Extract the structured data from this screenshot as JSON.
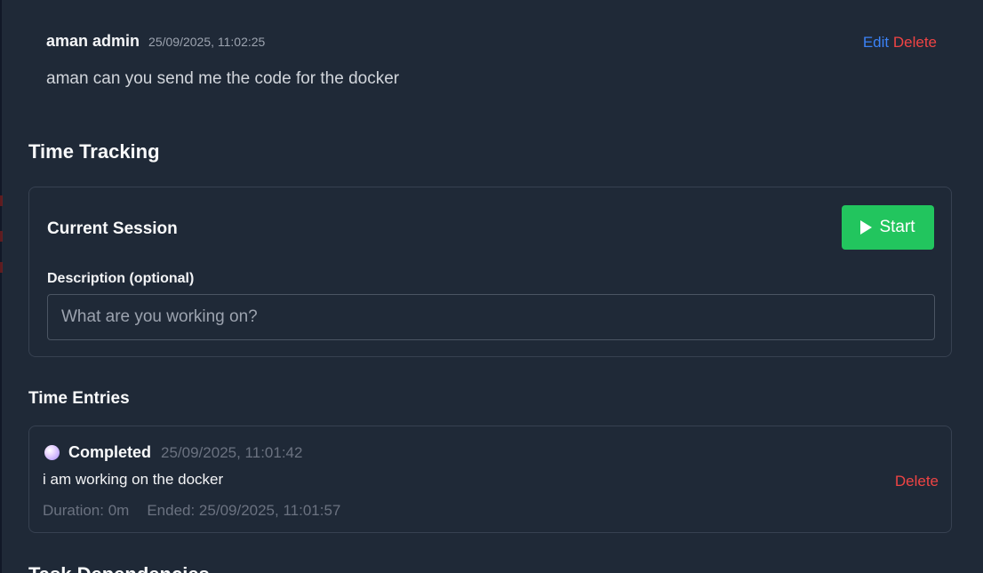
{
  "comment": {
    "author": "aman admin",
    "timestamp": "25/09/2025, 11:02:25",
    "body": "aman can you send me the code for the docker",
    "edit_label": "Edit",
    "delete_label": "Delete"
  },
  "time_tracking": {
    "title": "Time Tracking",
    "current_session": {
      "title": "Current Session",
      "start_label": "Start",
      "description_label": "Description (optional)",
      "description_placeholder": "What are you working on?",
      "description_value": ""
    },
    "entries_title": "Time Entries",
    "entries": [
      {
        "status": "Completed",
        "started": "25/09/2025, 11:01:42",
        "description": "i am working on the docker",
        "duration": "Duration: 0m",
        "ended": "Ended: 25/09/2025, 11:01:57",
        "delete_label": "Delete"
      }
    ]
  },
  "next_section": {
    "title": "Task Dependencies"
  },
  "colors": {
    "background": "#1f2937",
    "accent_green": "#22c55e",
    "link_blue": "#3b82f6",
    "danger_red": "#ef4444"
  }
}
